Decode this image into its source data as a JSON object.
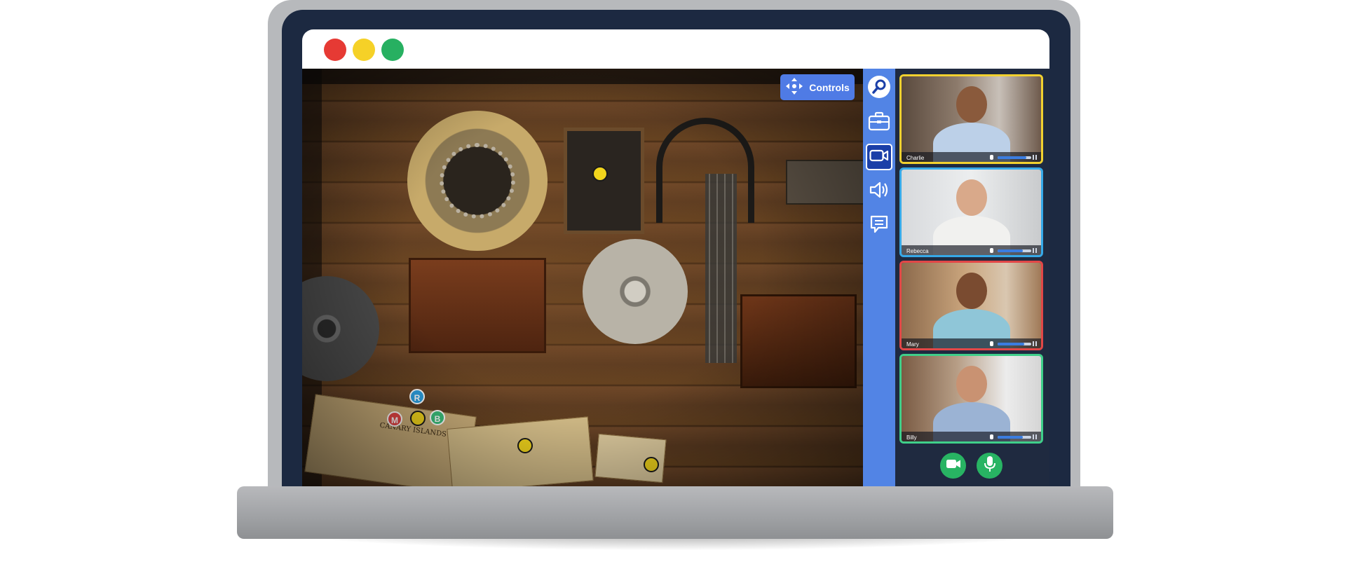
{
  "window": {
    "traffic_lights": {
      "close_color": "#e63a34",
      "minimize_color": "#f5d127",
      "maximize_color": "#27b061"
    }
  },
  "game": {
    "controls_label": "Controls",
    "map_title": "CANARY ISLANDS",
    "player_markers": [
      {
        "letter": "R",
        "color": "#2b9fe0"
      },
      {
        "letter": "M",
        "color": "#e54545"
      },
      {
        "letter": "B",
        "color": "#3bbf7a"
      }
    ]
  },
  "toolbar": {
    "items": [
      {
        "icon": "search-icon"
      },
      {
        "icon": "briefcase-icon"
      },
      {
        "icon": "video-camera-icon",
        "active": true
      },
      {
        "icon": "speaker-icon"
      },
      {
        "icon": "chat-icon"
      }
    ]
  },
  "participants": [
    {
      "name": "Charlie",
      "border_color": "#f2d12f",
      "volume": 0.85
    },
    {
      "name": "Rebecca",
      "border_color": "#36a9e8",
      "volume": 0.75
    },
    {
      "name": "Mary",
      "border_color": "#e24747",
      "volume": 0.8
    },
    {
      "name": "Billy",
      "border_color": "#3fcf8a",
      "volume": 0.75
    }
  ],
  "call_controls": {
    "camera_icon": "video-camera-icon",
    "mic_icon": "microphone-icon",
    "color": "#28b463"
  },
  "colors": {
    "accent": "#5284e5",
    "panel": "#1f2a40",
    "bezel": "#1c2941"
  }
}
